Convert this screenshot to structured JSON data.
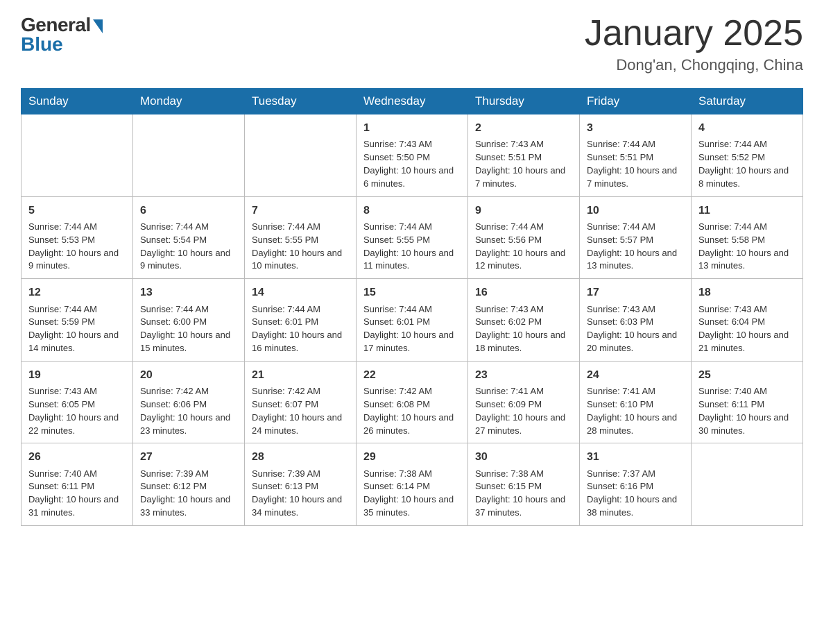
{
  "header": {
    "logo_general": "General",
    "logo_blue": "Blue",
    "title": "January 2025",
    "location": "Dong'an, Chongqing, China"
  },
  "days_of_week": [
    "Sunday",
    "Monday",
    "Tuesday",
    "Wednesday",
    "Thursday",
    "Friday",
    "Saturday"
  ],
  "weeks": [
    [
      {
        "day": "",
        "info": ""
      },
      {
        "day": "",
        "info": ""
      },
      {
        "day": "",
        "info": ""
      },
      {
        "day": "1",
        "info": "Sunrise: 7:43 AM\nSunset: 5:50 PM\nDaylight: 10 hours and 6 minutes."
      },
      {
        "day": "2",
        "info": "Sunrise: 7:43 AM\nSunset: 5:51 PM\nDaylight: 10 hours and 7 minutes."
      },
      {
        "day": "3",
        "info": "Sunrise: 7:44 AM\nSunset: 5:51 PM\nDaylight: 10 hours and 7 minutes."
      },
      {
        "day": "4",
        "info": "Sunrise: 7:44 AM\nSunset: 5:52 PM\nDaylight: 10 hours and 8 minutes."
      }
    ],
    [
      {
        "day": "5",
        "info": "Sunrise: 7:44 AM\nSunset: 5:53 PM\nDaylight: 10 hours and 9 minutes."
      },
      {
        "day": "6",
        "info": "Sunrise: 7:44 AM\nSunset: 5:54 PM\nDaylight: 10 hours and 9 minutes."
      },
      {
        "day": "7",
        "info": "Sunrise: 7:44 AM\nSunset: 5:55 PM\nDaylight: 10 hours and 10 minutes."
      },
      {
        "day": "8",
        "info": "Sunrise: 7:44 AM\nSunset: 5:55 PM\nDaylight: 10 hours and 11 minutes."
      },
      {
        "day": "9",
        "info": "Sunrise: 7:44 AM\nSunset: 5:56 PM\nDaylight: 10 hours and 12 minutes."
      },
      {
        "day": "10",
        "info": "Sunrise: 7:44 AM\nSunset: 5:57 PM\nDaylight: 10 hours and 13 minutes."
      },
      {
        "day": "11",
        "info": "Sunrise: 7:44 AM\nSunset: 5:58 PM\nDaylight: 10 hours and 13 minutes."
      }
    ],
    [
      {
        "day": "12",
        "info": "Sunrise: 7:44 AM\nSunset: 5:59 PM\nDaylight: 10 hours and 14 minutes."
      },
      {
        "day": "13",
        "info": "Sunrise: 7:44 AM\nSunset: 6:00 PM\nDaylight: 10 hours and 15 minutes."
      },
      {
        "day": "14",
        "info": "Sunrise: 7:44 AM\nSunset: 6:01 PM\nDaylight: 10 hours and 16 minutes."
      },
      {
        "day": "15",
        "info": "Sunrise: 7:44 AM\nSunset: 6:01 PM\nDaylight: 10 hours and 17 minutes."
      },
      {
        "day": "16",
        "info": "Sunrise: 7:43 AM\nSunset: 6:02 PM\nDaylight: 10 hours and 18 minutes."
      },
      {
        "day": "17",
        "info": "Sunrise: 7:43 AM\nSunset: 6:03 PM\nDaylight: 10 hours and 20 minutes."
      },
      {
        "day": "18",
        "info": "Sunrise: 7:43 AM\nSunset: 6:04 PM\nDaylight: 10 hours and 21 minutes."
      }
    ],
    [
      {
        "day": "19",
        "info": "Sunrise: 7:43 AM\nSunset: 6:05 PM\nDaylight: 10 hours and 22 minutes."
      },
      {
        "day": "20",
        "info": "Sunrise: 7:42 AM\nSunset: 6:06 PM\nDaylight: 10 hours and 23 minutes."
      },
      {
        "day": "21",
        "info": "Sunrise: 7:42 AM\nSunset: 6:07 PM\nDaylight: 10 hours and 24 minutes."
      },
      {
        "day": "22",
        "info": "Sunrise: 7:42 AM\nSunset: 6:08 PM\nDaylight: 10 hours and 26 minutes."
      },
      {
        "day": "23",
        "info": "Sunrise: 7:41 AM\nSunset: 6:09 PM\nDaylight: 10 hours and 27 minutes."
      },
      {
        "day": "24",
        "info": "Sunrise: 7:41 AM\nSunset: 6:10 PM\nDaylight: 10 hours and 28 minutes."
      },
      {
        "day": "25",
        "info": "Sunrise: 7:40 AM\nSunset: 6:11 PM\nDaylight: 10 hours and 30 minutes."
      }
    ],
    [
      {
        "day": "26",
        "info": "Sunrise: 7:40 AM\nSunset: 6:11 PM\nDaylight: 10 hours and 31 minutes."
      },
      {
        "day": "27",
        "info": "Sunrise: 7:39 AM\nSunset: 6:12 PM\nDaylight: 10 hours and 33 minutes."
      },
      {
        "day": "28",
        "info": "Sunrise: 7:39 AM\nSunset: 6:13 PM\nDaylight: 10 hours and 34 minutes."
      },
      {
        "day": "29",
        "info": "Sunrise: 7:38 AM\nSunset: 6:14 PM\nDaylight: 10 hours and 35 minutes."
      },
      {
        "day": "30",
        "info": "Sunrise: 7:38 AM\nSunset: 6:15 PM\nDaylight: 10 hours and 37 minutes."
      },
      {
        "day": "31",
        "info": "Sunrise: 7:37 AM\nSunset: 6:16 PM\nDaylight: 10 hours and 38 minutes."
      },
      {
        "day": "",
        "info": ""
      }
    ]
  ]
}
